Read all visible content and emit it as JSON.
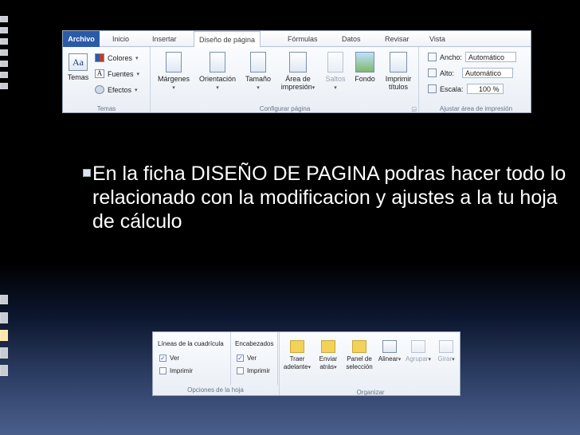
{
  "ribbon": {
    "tabs": [
      "Archivo",
      "Inicio",
      "Insertar",
      "Diseño de página",
      "Fórmulas",
      "Datos",
      "Revisar",
      "Vista"
    ],
    "active_tab": "Diseño de página",
    "temas": {
      "temas_label": "Temas",
      "colores": "Colores",
      "fuentes": "Fuentes",
      "efectos": "Efectos",
      "group_label": "Temas"
    },
    "configurar": {
      "margenes": "Márgenes",
      "orientacion": "Orientación",
      "tamano": "Tamaño",
      "area": "Área de",
      "area2": "impresión",
      "saltos": "Saltos",
      "fondo": "Fondo",
      "imprimir": "Imprimir",
      "titulos": "títulos",
      "group_label": "Configurar página"
    },
    "ajustar": {
      "ancho_label": "Ancho:",
      "ancho_value": "Automático",
      "alto_label": "Alto:",
      "alto_value": "Automático",
      "escala_label": "Escala:",
      "escala_value": "100 %",
      "group_label": "Ajustar área de impresión"
    }
  },
  "bullet_text": "En la ficha DISEÑO DE  PAGINA podras hacer todo lo relacionado con la modificacion y ajustes a la tu hoja de cálculo",
  "ribbon2": {
    "lineas": {
      "title": "Líneas de la cuadrícula",
      "ver": "Ver",
      "imprimir": "Imprimir"
    },
    "encabezados": {
      "title": "Encabezados",
      "ver": "Ver",
      "imprimir": "Imprimir"
    },
    "opciones_label": "Opciones de la hoja",
    "organizar": {
      "traer1": "Traer",
      "traer2": "adelante",
      "enviar1": "Enviar",
      "enviar2": "atrás",
      "panel1": "Panel de",
      "panel2": "selección",
      "alinear": "Alinear",
      "agrupar": "Agrupar",
      "girar": "Girar",
      "group_label": "Organizar"
    }
  }
}
